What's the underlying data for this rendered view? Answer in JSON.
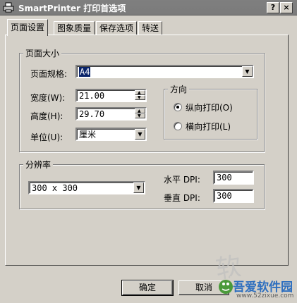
{
  "window": {
    "title": "SmartPrinter 打印首选项",
    "help_label": "?",
    "close_label": "×"
  },
  "tabs": [
    {
      "label": "页面设置",
      "active": true
    },
    {
      "label": "图象质量",
      "active": false
    },
    {
      "label": "保存选项",
      "active": false
    },
    {
      "label": "转送",
      "active": false
    }
  ],
  "page_size_group": {
    "title": "页面大小",
    "spec_label": "页面规格:",
    "spec_value": "A4",
    "width_label": "宽度(W):",
    "width_value": "21.00",
    "height_label": "高度(H):",
    "height_value": "29.70",
    "unit_label": "单位(U):",
    "unit_value": "厘米"
  },
  "orientation_group": {
    "title": "方向",
    "portrait_label": "纵向打印(O)",
    "landscape_label": "横向打印(L)",
    "selected": "portrait"
  },
  "resolution_group": {
    "title": "分辨率",
    "preset_value": "300  x  300",
    "h_dpi_label": "水平 DPI:",
    "h_dpi_value": "300",
    "v_dpi_label": "垂直 DPI:",
    "v_dpi_value": "300"
  },
  "buttons": {
    "ok_label": "确定",
    "cancel_label": "取消"
  },
  "watermark": {
    "site_name": "吾爱软件园",
    "site_url": "www.52zixue.com"
  }
}
